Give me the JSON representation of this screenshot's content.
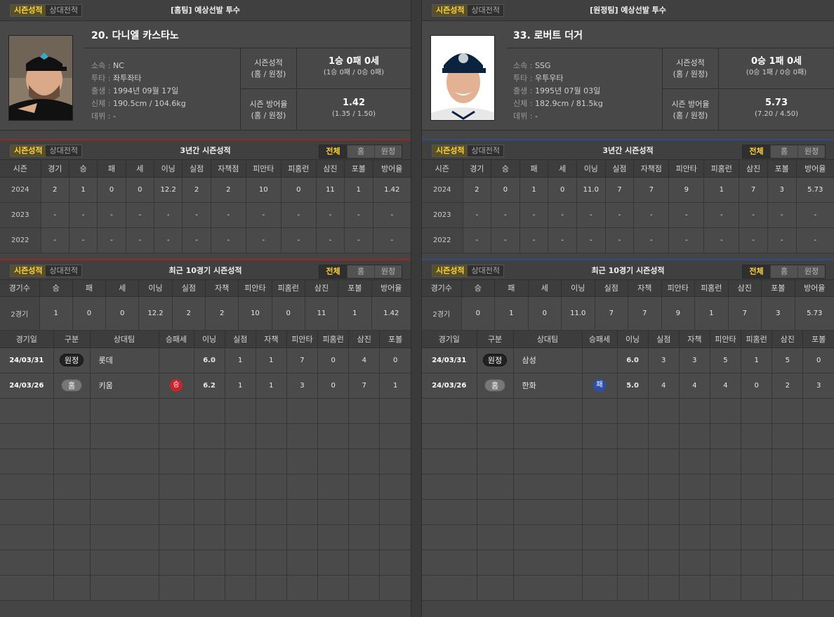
{
  "common": {
    "tab_season": "시즌성적",
    "tab_vs": "상대전적",
    "filter_all": "전체",
    "filter_home": "홈",
    "filter_away": "원정",
    "season_title": "3년간 시즌성적",
    "recent_title": "최근 10경기 시즌성적",
    "stat_label_record_1": "시즌성적",
    "stat_label_record_2": "(홈 / 원정)",
    "stat_label_era_1": "시즌 방어율",
    "stat_label_era_2": "(홈 / 원정)",
    "label_team": "소속 : ",
    "label_throw": "투타 : ",
    "label_birth": "출생 : ",
    "label_body": "신체 : ",
    "label_debut": "데뷔 : ",
    "season_headers": [
      "시즌",
      "경기",
      "승",
      "패",
      "세",
      "이닝",
      "실점",
      "자책점",
      "피안타",
      "피홈런",
      "삼진",
      "포볼",
      "방어율"
    ],
    "recent_headers": [
      "경기수",
      "승",
      "패",
      "세",
      "이닝",
      "실점",
      "자책",
      "피안타",
      "피홈런",
      "삼진",
      "포볼",
      "방어율"
    ],
    "log_headers": [
      "경기일",
      "구분",
      "상대팀",
      "승패세",
      "이닝",
      "실점",
      "자책",
      "피안타",
      "피홈런",
      "삼진",
      "포볼"
    ]
  },
  "home": {
    "header_title": "[홈팀] 예상선발 투수",
    "name": "20. 다니엘 카스타노",
    "team": "NC",
    "throw_bat": "좌투좌타",
    "birth": "1994년 09월 17일",
    "body": "190.5cm / 104.6kg",
    "debut": "-",
    "record_big": "1승 0패 0세",
    "record_small": "(1승 0패 / 0승 0패)",
    "era_big": "1.42",
    "era_small": "(1.35 / 1.50)",
    "season_rows": [
      [
        "2024",
        "2",
        "1",
        "0",
        "0",
        "12.2",
        "2",
        "2",
        "10",
        "0",
        "11",
        "1",
        "1.42"
      ],
      [
        "2023",
        "-",
        "-",
        "-",
        "-",
        "-",
        "-",
        "-",
        "-",
        "-",
        "-",
        "-",
        "-"
      ],
      [
        "2022",
        "-",
        "-",
        "-",
        "-",
        "-",
        "-",
        "-",
        "-",
        "-",
        "-",
        "-",
        "-"
      ]
    ],
    "recent_row": [
      "2경기",
      "1",
      "0",
      "0",
      "12.2",
      "2",
      "2",
      "10",
      "0",
      "11",
      "1",
      "1.42"
    ],
    "log": [
      {
        "date": "24/03/31",
        "type": "원정",
        "type_cls": "away",
        "opp": "롯데",
        "res": "",
        "res_cls": "",
        "ip": "6.0",
        "r": "1",
        "er": "1",
        "h": "7",
        "hr": "0",
        "so": "4",
        "bb": "0"
      },
      {
        "date": "24/03/26",
        "type": "홈",
        "type_cls": "home",
        "opp": "키움",
        "res": "승",
        "res_cls": "w",
        "ip": "6.2",
        "r": "1",
        "er": "1",
        "h": "3",
        "hr": "0",
        "so": "7",
        "bb": "1"
      }
    ]
  },
  "away": {
    "header_title": "[원정팀] 예상선발 투수",
    "name": "33. 로버트 더거",
    "team": "SSG",
    "throw_bat": "우투우타",
    "birth": "1995년 07월 03일",
    "body": "182.9cm / 81.5kg",
    "debut": "-",
    "record_big": "0승 1패 0세",
    "record_small": "(0승 1패 / 0승 0패)",
    "era_big": "5.73",
    "era_small": "(7.20 / 4.50)",
    "season_rows": [
      [
        "2024",
        "2",
        "0",
        "1",
        "0",
        "11.0",
        "7",
        "7",
        "9",
        "1",
        "7",
        "3",
        "5.73"
      ],
      [
        "2023",
        "-",
        "-",
        "-",
        "-",
        "-",
        "-",
        "-",
        "-",
        "-",
        "-",
        "-",
        "-"
      ],
      [
        "2022",
        "-",
        "-",
        "-",
        "-",
        "-",
        "-",
        "-",
        "-",
        "-",
        "-",
        "-",
        "-"
      ]
    ],
    "recent_row": [
      "2경기",
      "0",
      "1",
      "0",
      "11.0",
      "7",
      "7",
      "9",
      "1",
      "7",
      "3",
      "5.73"
    ],
    "log": [
      {
        "date": "24/03/31",
        "type": "원정",
        "type_cls": "away",
        "opp": "삼성",
        "res": "",
        "res_cls": "",
        "ip": "6.0",
        "r": "3",
        "er": "3",
        "h": "5",
        "hr": "1",
        "so": "5",
        "bb": "0"
      },
      {
        "date": "24/03/26",
        "type": "홈",
        "type_cls": "home",
        "opp": "한화",
        "res": "패",
        "res_cls": "l",
        "ip": "5.0",
        "r": "4",
        "er": "4",
        "h": "4",
        "hr": "0",
        "so": "2",
        "bb": "3"
      }
    ]
  },
  "colors": {
    "accent": "#ffd23a",
    "win": "#c9242a",
    "loss": "#2c4fa8",
    "home_line": "#9a2626",
    "away_line": "#2f4c8a"
  }
}
